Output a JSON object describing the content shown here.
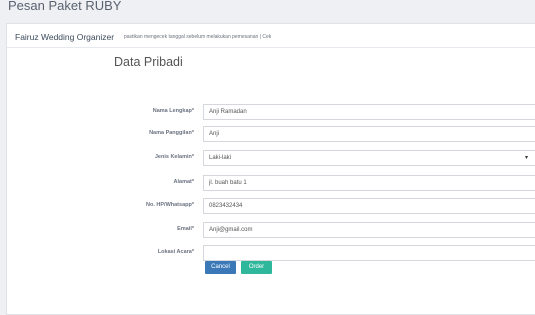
{
  "page": {
    "title": "Pesan Paket RUBY"
  },
  "header": {
    "org_name": "Fairuz Wedding Organizer",
    "note": "pastikan mengecek tanggal sebelum melakukan pemesanan | Cek"
  },
  "form": {
    "section_title": "Data Pribadi",
    "fields": [
      {
        "label": "Nama Lengkap*",
        "value": "Anji Ramadan"
      },
      {
        "label": "Nama Panggilan*",
        "value": "Anji"
      },
      {
        "label": "Jenis Kelamin*",
        "value": "Laki-laki",
        "type": "select"
      },
      {
        "label": "Alamat*",
        "value": "jl. buah batu 1"
      },
      {
        "label": "No. HP/Whatsapp*",
        "value": "0823432434"
      },
      {
        "label": "Email*",
        "value": "Anji@gmail.com"
      },
      {
        "label": "Lokasi Acara*",
        "value": ""
      }
    ],
    "select_arrow_icon": "caret-down-icon"
  },
  "actions": {
    "cancel_label": "Cancel",
    "order_label": "Order",
    "colors": {
      "cancel": "#3a78b7",
      "order": "#2fb79b"
    }
  }
}
